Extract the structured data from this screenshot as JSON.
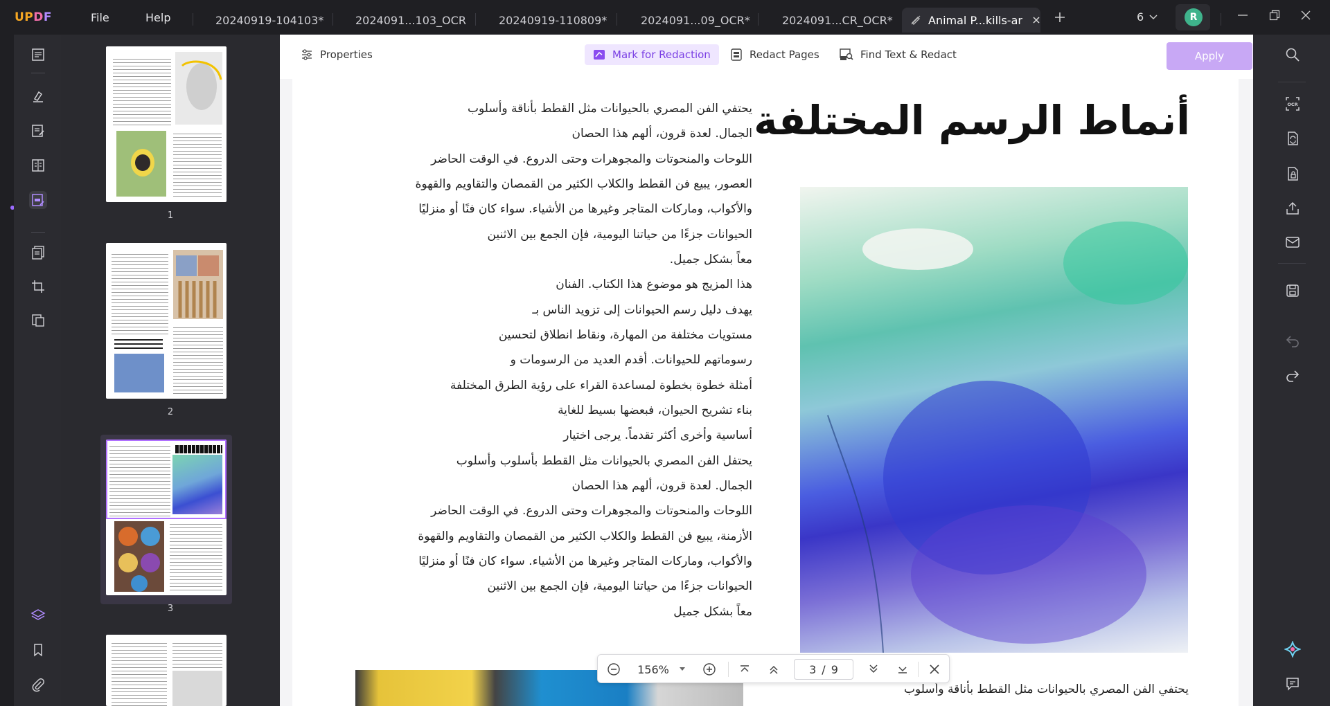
{
  "app": {
    "logo_u": "UP",
    "logo_d": "D",
    "logo_f": "F"
  },
  "menu": {
    "file": "File",
    "help": "Help"
  },
  "tabs": [
    {
      "label": "20240919-104103*"
    },
    {
      "label": "2024091...103_OCR"
    },
    {
      "label": "20240919-110809*"
    },
    {
      "label": "2024091...09_OCR*"
    },
    {
      "label": "2024091...CR_OCR*"
    },
    {
      "label": "Animal P...kills-ar"
    }
  ],
  "tab_count": "6",
  "avatar_initial": "R",
  "toolbar": {
    "properties": "Properties",
    "mark_for_redaction": "Mark for Redaction",
    "redact_pages": "Redact Pages",
    "find_text_redact": "Find Text & Redact",
    "apply": "Apply"
  },
  "thumbnails": [
    {
      "num": "1"
    },
    {
      "num": "2"
    },
    {
      "num": "3"
    }
  ],
  "document": {
    "heading": "أنماط الرسم المختلفة",
    "body_lines": [
      "يحتفي الفن المصري بالحيوانات مثل القطط بأناقة وأسلوب",
      "الجمال. لعدة قرون، ألهم هذا الحصان",
      "اللوحات والمنحوتات والمجوهرات وحتى الدروع. في الوقت الحاضر",
      "العصور، يبيع فن القطط والكلاب الكثير من القمصان والتقاويم والقهوة",
      "والأكواب، وماركات المتاجر وغيرها من الأشياء. سواء كان فنًا أو منزليًا",
      "الحيوانات جزءًا من حياتنا اليومية، فإن الجمع بين الاثنين",
      "معاً بشكل جميل.",
      "هذا المزيج هو موضوع هذا الكتاب. الفنان",
      "يهدف دليل رسم الحيوانات إلى تزويد الناس بـ",
      "مستويات مختلفة من المهارة، ونقاط انطلاق لتحسين",
      "رسوماتهم للحيوانات. أقدم العديد من الرسومات و",
      "أمثلة خطوة بخطوة لمساعدة القراء على رؤية الطرق المختلفة",
      "بناء تشريح الحيوان، فبعضها بسيط للغاية",
      "أساسية وأخرى أكثر تقدماً. يرجى اختيار",
      "يحتفل الفن المصري بالحيوانات مثل القطط بأسلوب وأسلوب",
      "الجمال. لعدة قرون، ألهم هذا الحصان",
      "اللوحات والمنحوتات والمجوهرات وحتى الدروع. في الوقت الحاضر",
      "الأزمنة، يبيع فن القطط والكلاب الكثير من القمصان والتقاويم والقهوة",
      "والأكواب، وماركات المتاجر وغيرها من الأشياء. سواء كان فنًا أو منزليًا",
      "الحيوانات جزءًا من حياتنا اليومية، فإن الجمع بين الاثنين",
      "معاً بشكل جميل"
    ],
    "bottom_line": "يحتفي الفن المصري بالحيوانات مثل القطط بأناقة وأسلوب"
  },
  "zoom": {
    "level": "156%",
    "current_page": "3",
    "separator": "/",
    "total_pages": "9"
  }
}
